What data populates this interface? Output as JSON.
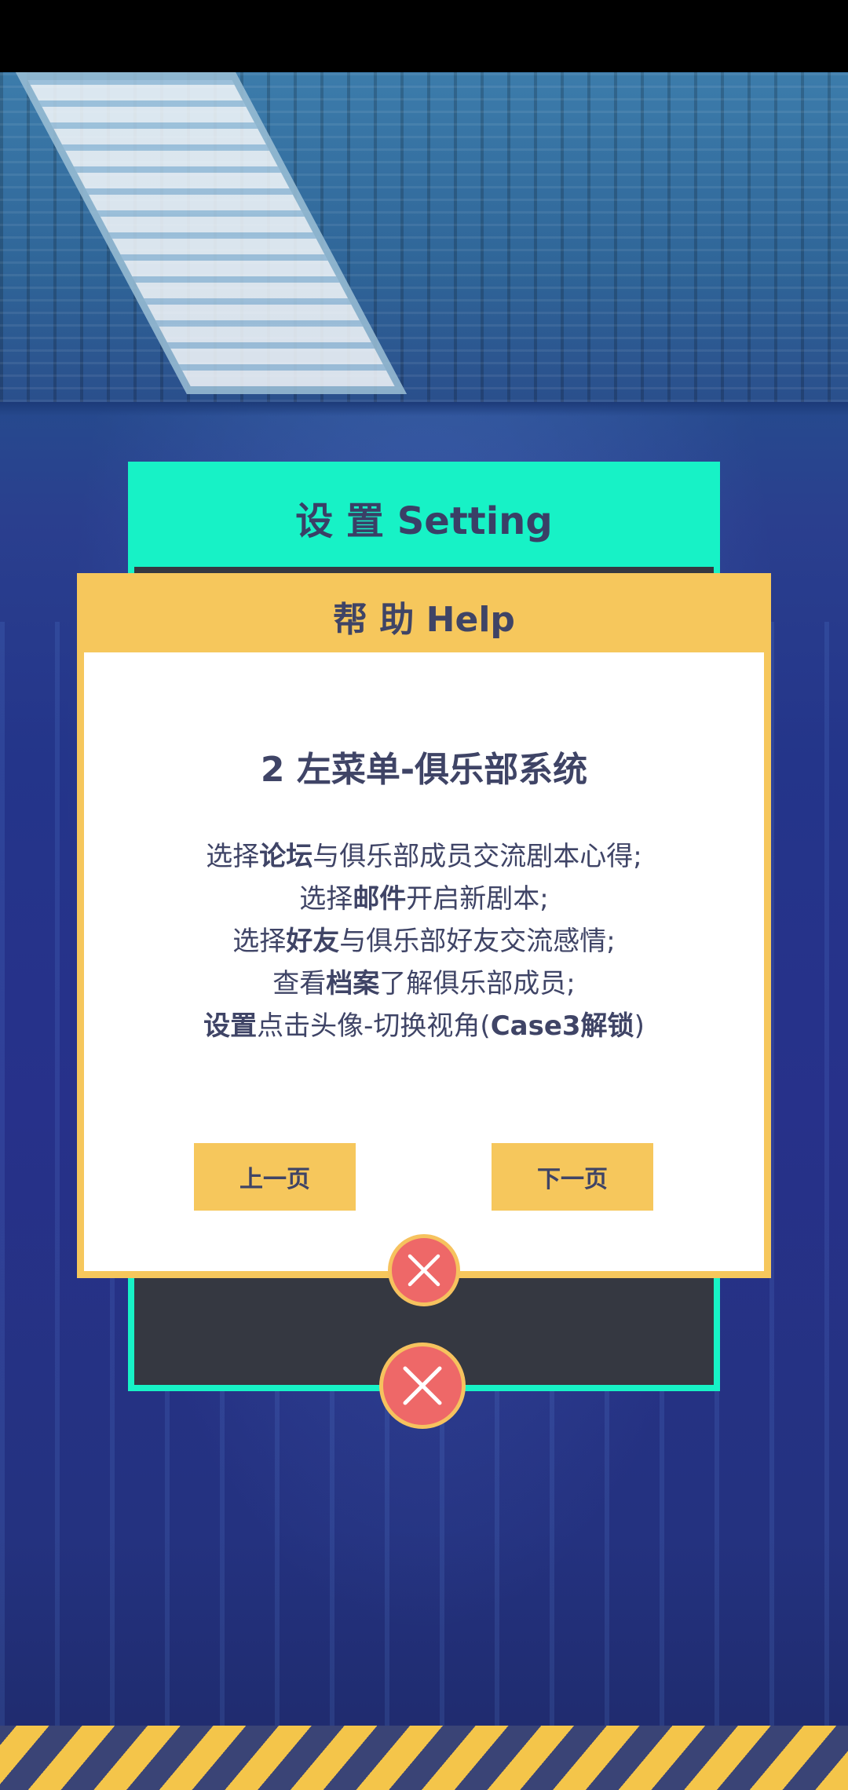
{
  "setting_panel": {
    "title": "设 置 Setting"
  },
  "help_dialog": {
    "title": "帮 助 Help",
    "section_title": "2 左菜单-俱乐部系统",
    "lines": [
      {
        "pre": "选择",
        "bold": "论坛",
        "post": "与俱乐部成员交流剧本心得;"
      },
      {
        "pre": "选择",
        "bold": "邮件",
        "post": "开启新剧本;"
      },
      {
        "pre": "选择",
        "bold": "好友",
        "post": "与俱乐部好友交流感情;"
      },
      {
        "pre": "查看",
        "bold": "档案",
        "post": "了解俱乐部成员;"
      },
      {
        "bold": "设置",
        "mid": "点击头像-切换视角(",
        "bold2": "Case3解锁",
        "post": ")"
      }
    ],
    "prev_label": "上一页",
    "next_label": "下一页"
  },
  "icons": {
    "help_close": "close-icon",
    "setting_close": "close-icon"
  },
  "colors": {
    "setting_accent": "#17f2c6",
    "help_accent": "#f6c75c",
    "close_red": "#ee6868",
    "text_dark": "#3f4466"
  }
}
